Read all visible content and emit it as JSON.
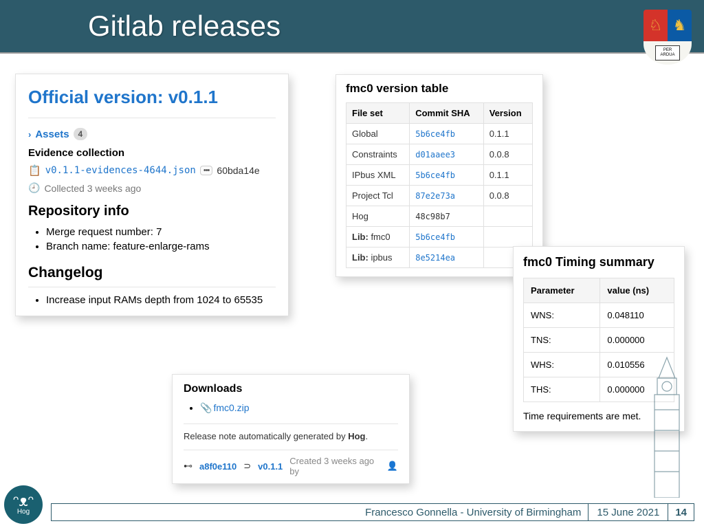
{
  "slide": {
    "title": "Gitlab releases",
    "author": "Francesco Gonnella - University of Birmingham",
    "date": "15 June 2021",
    "page": "14"
  },
  "release": {
    "title": "Official version: v0.1.1",
    "assets_label": "Assets",
    "assets_count": "4",
    "evidence_heading": "Evidence collection",
    "evidence_file": "v0.1.1-evidences-4644.json",
    "evidence_sha": "60bda14e",
    "collected": "Collected 3 weeks ago",
    "repo_info_heading": "Repository info",
    "merge_request": "Merge request number: 7",
    "branch_name": "Branch name: feature-enlarge-rams",
    "changelog_heading": "Changelog",
    "changelog_item": "Increase input RAMs depth from 1024 to 65535"
  },
  "downloads": {
    "heading": "Downloads",
    "file": "fmc0.zip",
    "note_prefix": "Release note automatically generated by ",
    "note_bold": "Hog",
    "note_suffix": ".",
    "commit": "a8f0e110",
    "tag": "v0.1.1",
    "created": "Created 3 weeks ago by"
  },
  "version_table": {
    "title": "fmc0 version table",
    "headers": {
      "c1": "File set",
      "c2": "Commit SHA",
      "c3": "Version"
    },
    "rows": [
      {
        "fileset": "Global",
        "sha": "5b6ce4fb",
        "ver": "0.1.1",
        "link": true
      },
      {
        "fileset": "Constraints",
        "sha": "d01aaee3",
        "ver": "0.0.8",
        "link": true
      },
      {
        "fileset": "IPbus XML",
        "sha": "5b6ce4fb",
        "ver": "0.1.1",
        "link": true
      },
      {
        "fileset": "Project Tcl",
        "sha": "87e2e73a",
        "ver": "0.0.8",
        "link": true
      },
      {
        "fileset": "Hog",
        "sha": "48c98b7",
        "ver": "",
        "link": false
      },
      {
        "fileset": "Lib: fmc0",
        "sha": "5b6ce4fb",
        "ver": "",
        "link": true
      },
      {
        "fileset": "Lib: ipbus",
        "sha": "8e5214ea",
        "ver": "",
        "link": true
      }
    ]
  },
  "timing": {
    "title": "fmc0 Timing summary",
    "headers": {
      "c1": "Parameter",
      "c2": "value (ns)"
    },
    "rows": [
      {
        "p": "WNS:",
        "v": "0.048110"
      },
      {
        "p": "TNS:",
        "v": "0.000000"
      },
      {
        "p": "WHS:",
        "v": "0.010556"
      },
      {
        "p": "THS:",
        "v": "0.000000"
      }
    ],
    "note": "Time requirements are met."
  }
}
